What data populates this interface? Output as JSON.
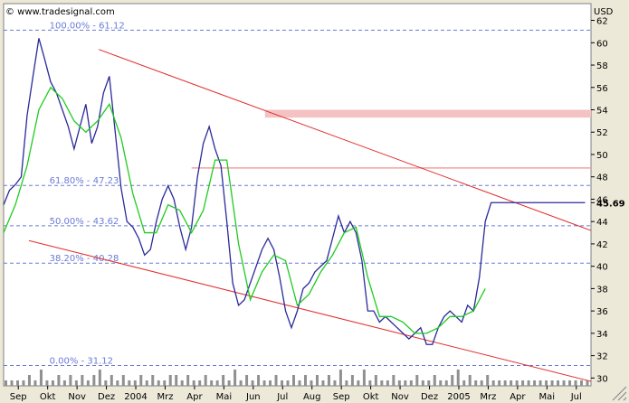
{
  "logo": {
    "text": "© www.tradesignal.com"
  },
  "chart_data": {
    "type": "line",
    "currency": "USD",
    "ylim": [
      29.3,
      63.5
    ],
    "y_ticks": [
      30,
      32,
      34,
      36,
      38,
      40,
      42,
      44,
      46,
      48,
      50,
      52,
      54,
      56,
      58,
      60,
      62
    ],
    "x_ticks": [
      "Sep",
      "Okt",
      "Nov",
      "Dez",
      "2004",
      "Mrz",
      "Apr",
      "Mai",
      "Jun",
      "Jul",
      "Aug",
      "Sep",
      "Okt",
      "Nov",
      "Dez",
      "2005",
      "Mrz",
      "Apr",
      "Mai",
      "Jul"
    ],
    "x_index_range": [
      0,
      100
    ],
    "last_price": {
      "label": "45.69",
      "value": 45.69
    },
    "fib_levels": [
      {
        "label": "100.00% - 61.12",
        "value": 61.12
      },
      {
        "label": "61.80% - 47.23",
        "value": 47.23
      },
      {
        "label": "50.00% - 43.62",
        "value": 43.62
      },
      {
        "label": "38.20% - 40.28",
        "value": 40.28
      },
      {
        "label": "0.00% - 31.12",
        "value": 31.12
      }
    ],
    "resistance_lines": [
      48.8
    ],
    "resistance_band": [
      53.3,
      54.0
    ],
    "channel_upper": {
      "x": [
        16.2,
        100
      ],
      "y": [
        59.4,
        43.2
      ]
    },
    "channel_lower": {
      "x": [
        4.3,
        100
      ],
      "y": [
        42.3,
        29.7
      ]
    },
    "series": [
      {
        "type": "close",
        "x": [
          0,
          1,
          2,
          3,
          4,
          5,
          6,
          7,
          8,
          9,
          10,
          11,
          12,
          13,
          14,
          15,
          16,
          17,
          18,
          19,
          20,
          21,
          22,
          23,
          24,
          25,
          26,
          27,
          28,
          29,
          30,
          31,
          32,
          33,
          34,
          35,
          36,
          37,
          38,
          39,
          40,
          41,
          42,
          43,
          44,
          45,
          46,
          47,
          48,
          49,
          50,
          51,
          52,
          53,
          54,
          55,
          56,
          57,
          58,
          59,
          60,
          61,
          62,
          63,
          64,
          65,
          66,
          67,
          68,
          69,
          70,
          71,
          72,
          73,
          74,
          75,
          76,
          77,
          78,
          79,
          80,
          81,
          82,
          83,
          84,
          85,
          86,
          87,
          88,
          89,
          90,
          91,
          92,
          93,
          94,
          95,
          96,
          97,
          98,
          99
        ],
        "values": [
          45.5,
          46.8,
          47.3,
          48.0,
          53.5,
          57.0,
          60.4,
          58.5,
          56.5,
          55.5,
          54.0,
          52.5,
          50.5,
          52.5,
          54.5,
          51.0,
          52.5,
          55.5,
          57.0,
          52.0,
          47.0,
          44.0,
          43.5,
          42.5,
          41.0,
          41.5,
          44.0,
          46.0,
          47.2,
          46.0,
          43.5,
          41.5,
          43.5,
          48.0,
          51.0,
          52.5,
          50.5,
          49.0,
          44.0,
          38.5,
          36.5,
          37.0,
          38.5,
          40.0,
          41.5,
          42.5,
          41.5,
          39.0,
          36.0,
          34.5,
          36.0,
          38.0,
          38.5,
          39.5,
          40.0,
          40.5,
          42.5,
          44.5,
          43.0,
          44.0,
          43.0,
          40.5,
          36.0,
          36.0,
          35.0,
          35.5,
          35.0,
          34.5,
          34.0,
          33.5,
          34.0,
          34.5,
          33.0,
          33.0,
          34.5,
          35.5,
          36.0,
          35.5,
          35.0,
          36.5,
          36.0,
          39.0,
          44.0,
          45.69,
          45.69,
          45.69,
          45.69,
          45.69,
          45.69,
          45.69,
          45.69,
          45.69,
          45.69,
          45.69,
          45.69,
          45.69,
          45.69,
          45.69,
          45.69,
          45.69
        ]
      },
      {
        "type": "average",
        "x": [
          0,
          2,
          4,
          6,
          8,
          10,
          12,
          14,
          16,
          18,
          20,
          22,
          24,
          26,
          28,
          30,
          32,
          34,
          36,
          38,
          40,
          42,
          44,
          46,
          48,
          50,
          52,
          54,
          56,
          58,
          60,
          62,
          64,
          66,
          68,
          70,
          72,
          74,
          76,
          78,
          80,
          82
        ],
        "values": [
          43.0,
          45.5,
          49.0,
          54.0,
          56.0,
          55.0,
          53.0,
          52.0,
          53.0,
          54.5,
          51.5,
          46.5,
          43.0,
          43.0,
          45.5,
          45.0,
          43.0,
          45.0,
          49.5,
          49.5,
          42.0,
          37.0,
          39.5,
          41.0,
          40.5,
          36.5,
          37.5,
          39.5,
          41.0,
          43.0,
          43.5,
          39.0,
          35.5,
          35.5,
          35.0,
          34.0,
          34.0,
          34.5,
          35.5,
          35.5,
          36.0,
          38.0
        ]
      }
    ],
    "volume": [
      1,
      1,
      1,
      1,
      2,
      1,
      3,
      1,
      1,
      2,
      1,
      2,
      1,
      2,
      1,
      2,
      3,
      1,
      2,
      1,
      2,
      1,
      1,
      2,
      1,
      2,
      1,
      1,
      2,
      2,
      1,
      2,
      1,
      1,
      2,
      1,
      1,
      2,
      1,
      3,
      1,
      2,
      1,
      2,
      1,
      1,
      2,
      1,
      1,
      2,
      1,
      2,
      1,
      2,
      1,
      2,
      1,
      3,
      1,
      2,
      1,
      3,
      1,
      2,
      1,
      1,
      2,
      1,
      1,
      1,
      2,
      1,
      1,
      2,
      1,
      1,
      2,
      3,
      1,
      2,
      1,
      1,
      2,
      1,
      1,
      1,
      1,
      1,
      1,
      1,
      1,
      1,
      1,
      1,
      1,
      1,
      1,
      1,
      1,
      1
    ]
  }
}
